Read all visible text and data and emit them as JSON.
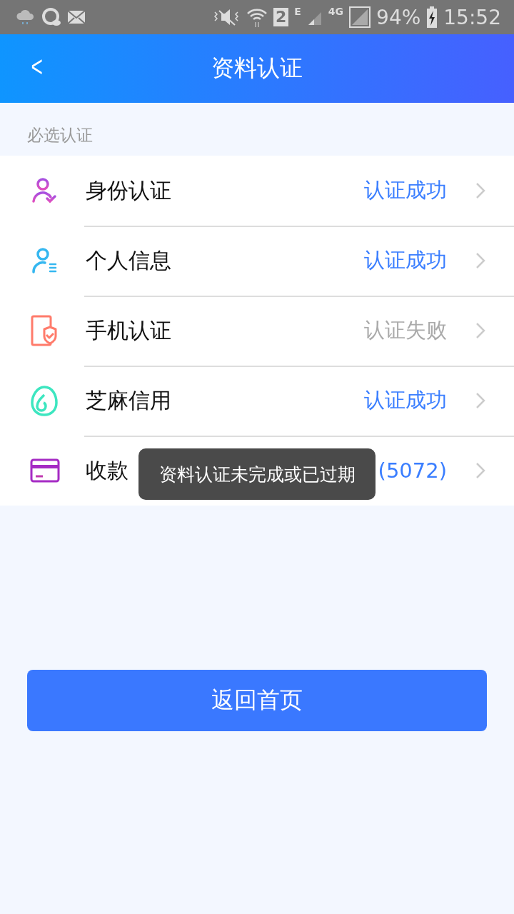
{
  "status_bar": {
    "sim": "2",
    "network_e": "E",
    "network_4g": "4G",
    "battery": "94%",
    "time": "15:52"
  },
  "header": {
    "back": "<",
    "title": "资料认证"
  },
  "section": {
    "label": "必选认证"
  },
  "items": [
    {
      "kind": "identity",
      "label": "身份认证",
      "status": "认证成功",
      "verified": true
    },
    {
      "kind": "profile",
      "label": "个人信息",
      "status": "认证成功",
      "verified": true
    },
    {
      "kind": "phone",
      "label": "手机认证",
      "status": "认证失败",
      "verified": false
    },
    {
      "kind": "credit",
      "label": "芝麻信用",
      "status": "认证成功",
      "verified": true
    },
    {
      "kind": "bank",
      "label": "收款",
      "status": "(5072)",
      "verified": true
    }
  ],
  "toast": "资料认证未完成或已过期",
  "button": "返回首页"
}
